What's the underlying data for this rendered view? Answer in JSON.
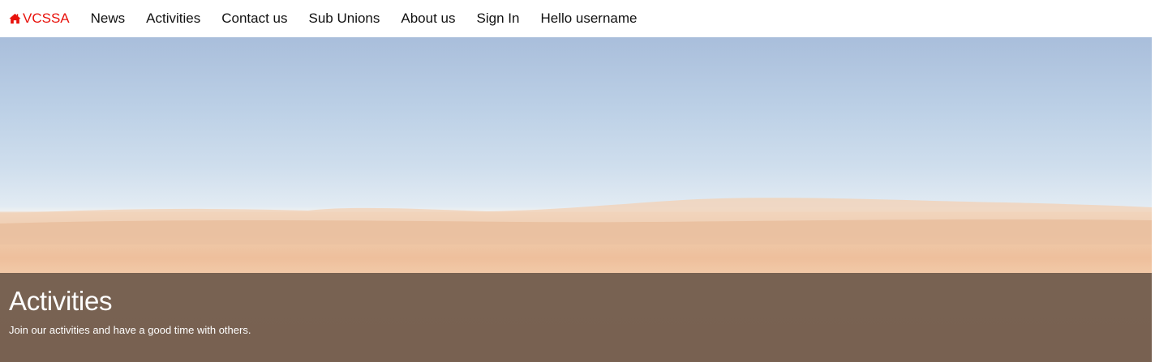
{
  "nav": {
    "brand": "VCSSA",
    "brand_icon": "home-icon",
    "brand_color": "#e8120c",
    "items": [
      {
        "label": "News"
      },
      {
        "label": "Activities"
      },
      {
        "label": "Contact us"
      },
      {
        "label": "Sub Unions"
      },
      {
        "label": "About us"
      },
      {
        "label": "Sign In"
      },
      {
        "label": "Hello username"
      }
    ]
  },
  "hero": {
    "title": "Activities",
    "subtitle": "Join our activities and have a good time with others."
  }
}
